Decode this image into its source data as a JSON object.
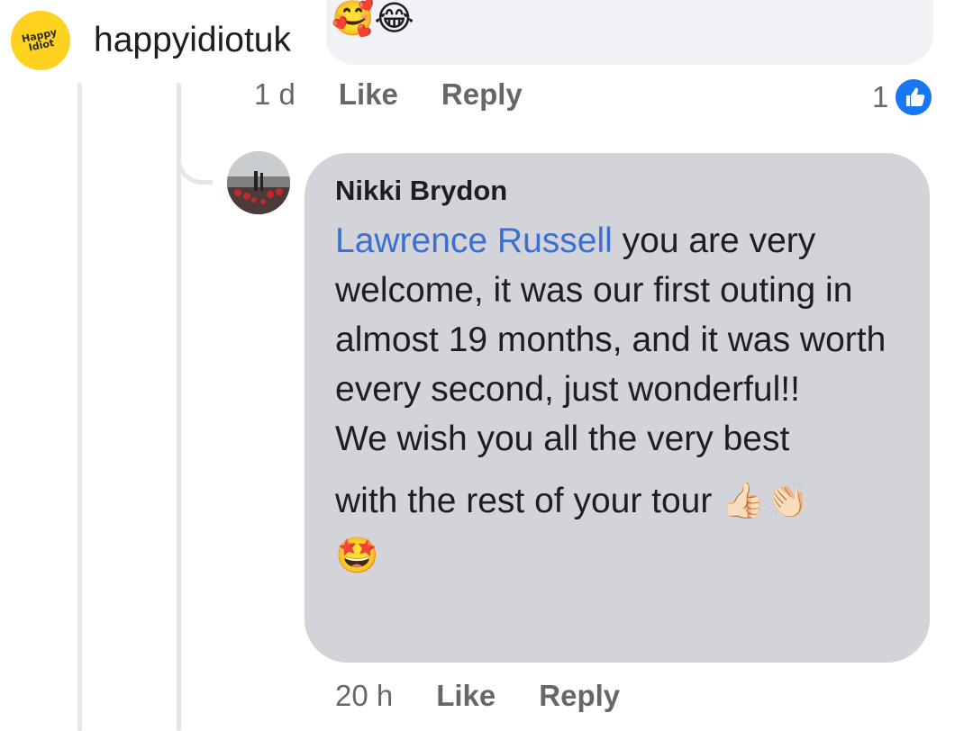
{
  "watermark": {
    "logo_text_1": "Happy",
    "logo_text_2": "Idiot",
    "username": "happyidiotuk"
  },
  "previous_comment": {
    "emoji_tail": "🥰😂",
    "time": "1 d",
    "like_label": "Like",
    "reply_label": "Reply",
    "reaction_count": "1",
    "reaction_icon": "like-icon",
    "reaction_color": "#1877f2"
  },
  "reply_comment": {
    "author": "Nikki Brydon",
    "mention": "Lawrence Russell",
    "text_1": " you are very welcome, it was our first outing in almost 19 months, and it was worth every second, just wonderful!!",
    "text_2": "We wish you all the very best",
    "text_3": "with the rest of your tour ",
    "emoji_1": "👍🏻👏🏻",
    "emoji_2": "🤩",
    "time": "20 h",
    "like_label": "Like",
    "reply_label": "Reply",
    "mention_color": "#3b6fd1",
    "bubble_color": "#d3d4d9"
  }
}
